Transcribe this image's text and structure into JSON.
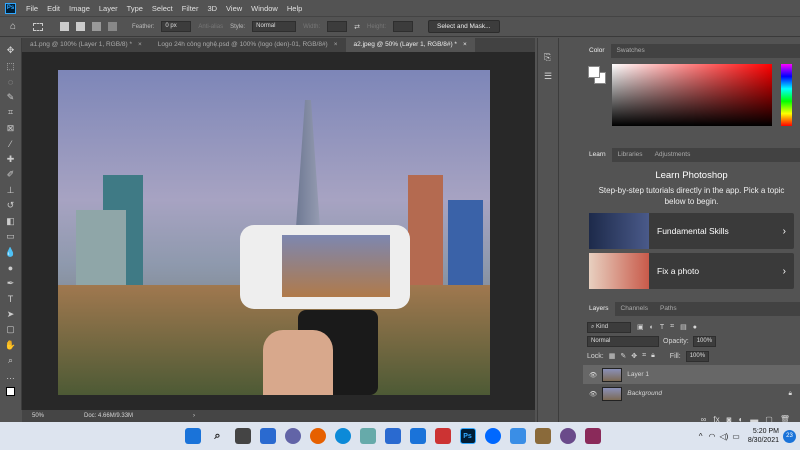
{
  "menu": {
    "app_icon": "Ps",
    "items": [
      "File",
      "Edit",
      "Image",
      "Layer",
      "Type",
      "Select",
      "Filter",
      "3D",
      "View",
      "Window",
      "Help"
    ]
  },
  "options": {
    "feather_label": "Feather:",
    "feather_value": "0 px",
    "antialias_label": "Anti-alias",
    "style_label": "Style:",
    "style_value": "Normal",
    "width_label": "Width:",
    "height_label": "Height:",
    "select_mask": "Select and Mask..."
  },
  "tabs": [
    {
      "label": "a1.png @ 100% (Layer 1, RGB/8) *"
    },
    {
      "label": "Logo 24h công nghệ.psd @ 100% (logo (den)-01, RGB/8#)"
    },
    {
      "label": "a2.jpeg @ 50% (Layer 1, RGB/8#) *"
    }
  ],
  "tab_close": "×",
  "status": {
    "zoom": "50%",
    "doc": "Doc: 4.66M/9.33M",
    "arrow": "›"
  },
  "color_panel": {
    "tabs": [
      "Color",
      "Swatches"
    ]
  },
  "learn_panel": {
    "tabs": [
      "Learn",
      "Libraries",
      "Adjustments"
    ],
    "title": "Learn Photoshop",
    "description": "Step-by-step tutorials directly in the app. Pick a topic below to begin.",
    "cards": [
      {
        "label": "Fundamental Skills"
      },
      {
        "label": "Fix a photo"
      }
    ],
    "chevron": "›"
  },
  "layers_panel": {
    "tabs": [
      "Layers",
      "Channels",
      "Paths"
    ],
    "filter": "Kind",
    "blend": "Normal",
    "opacity_label": "Opacity:",
    "opacity": "100%",
    "lock_label": "Lock:",
    "fill_label": "Fill:",
    "fill": "100%",
    "layers": [
      {
        "name": "Layer 1",
        "selected": true
      },
      {
        "name": "Background",
        "locked": true
      }
    ]
  },
  "taskbar": {
    "time": "5:20 PM",
    "date": "8/30/2021",
    "notifications": "23"
  }
}
